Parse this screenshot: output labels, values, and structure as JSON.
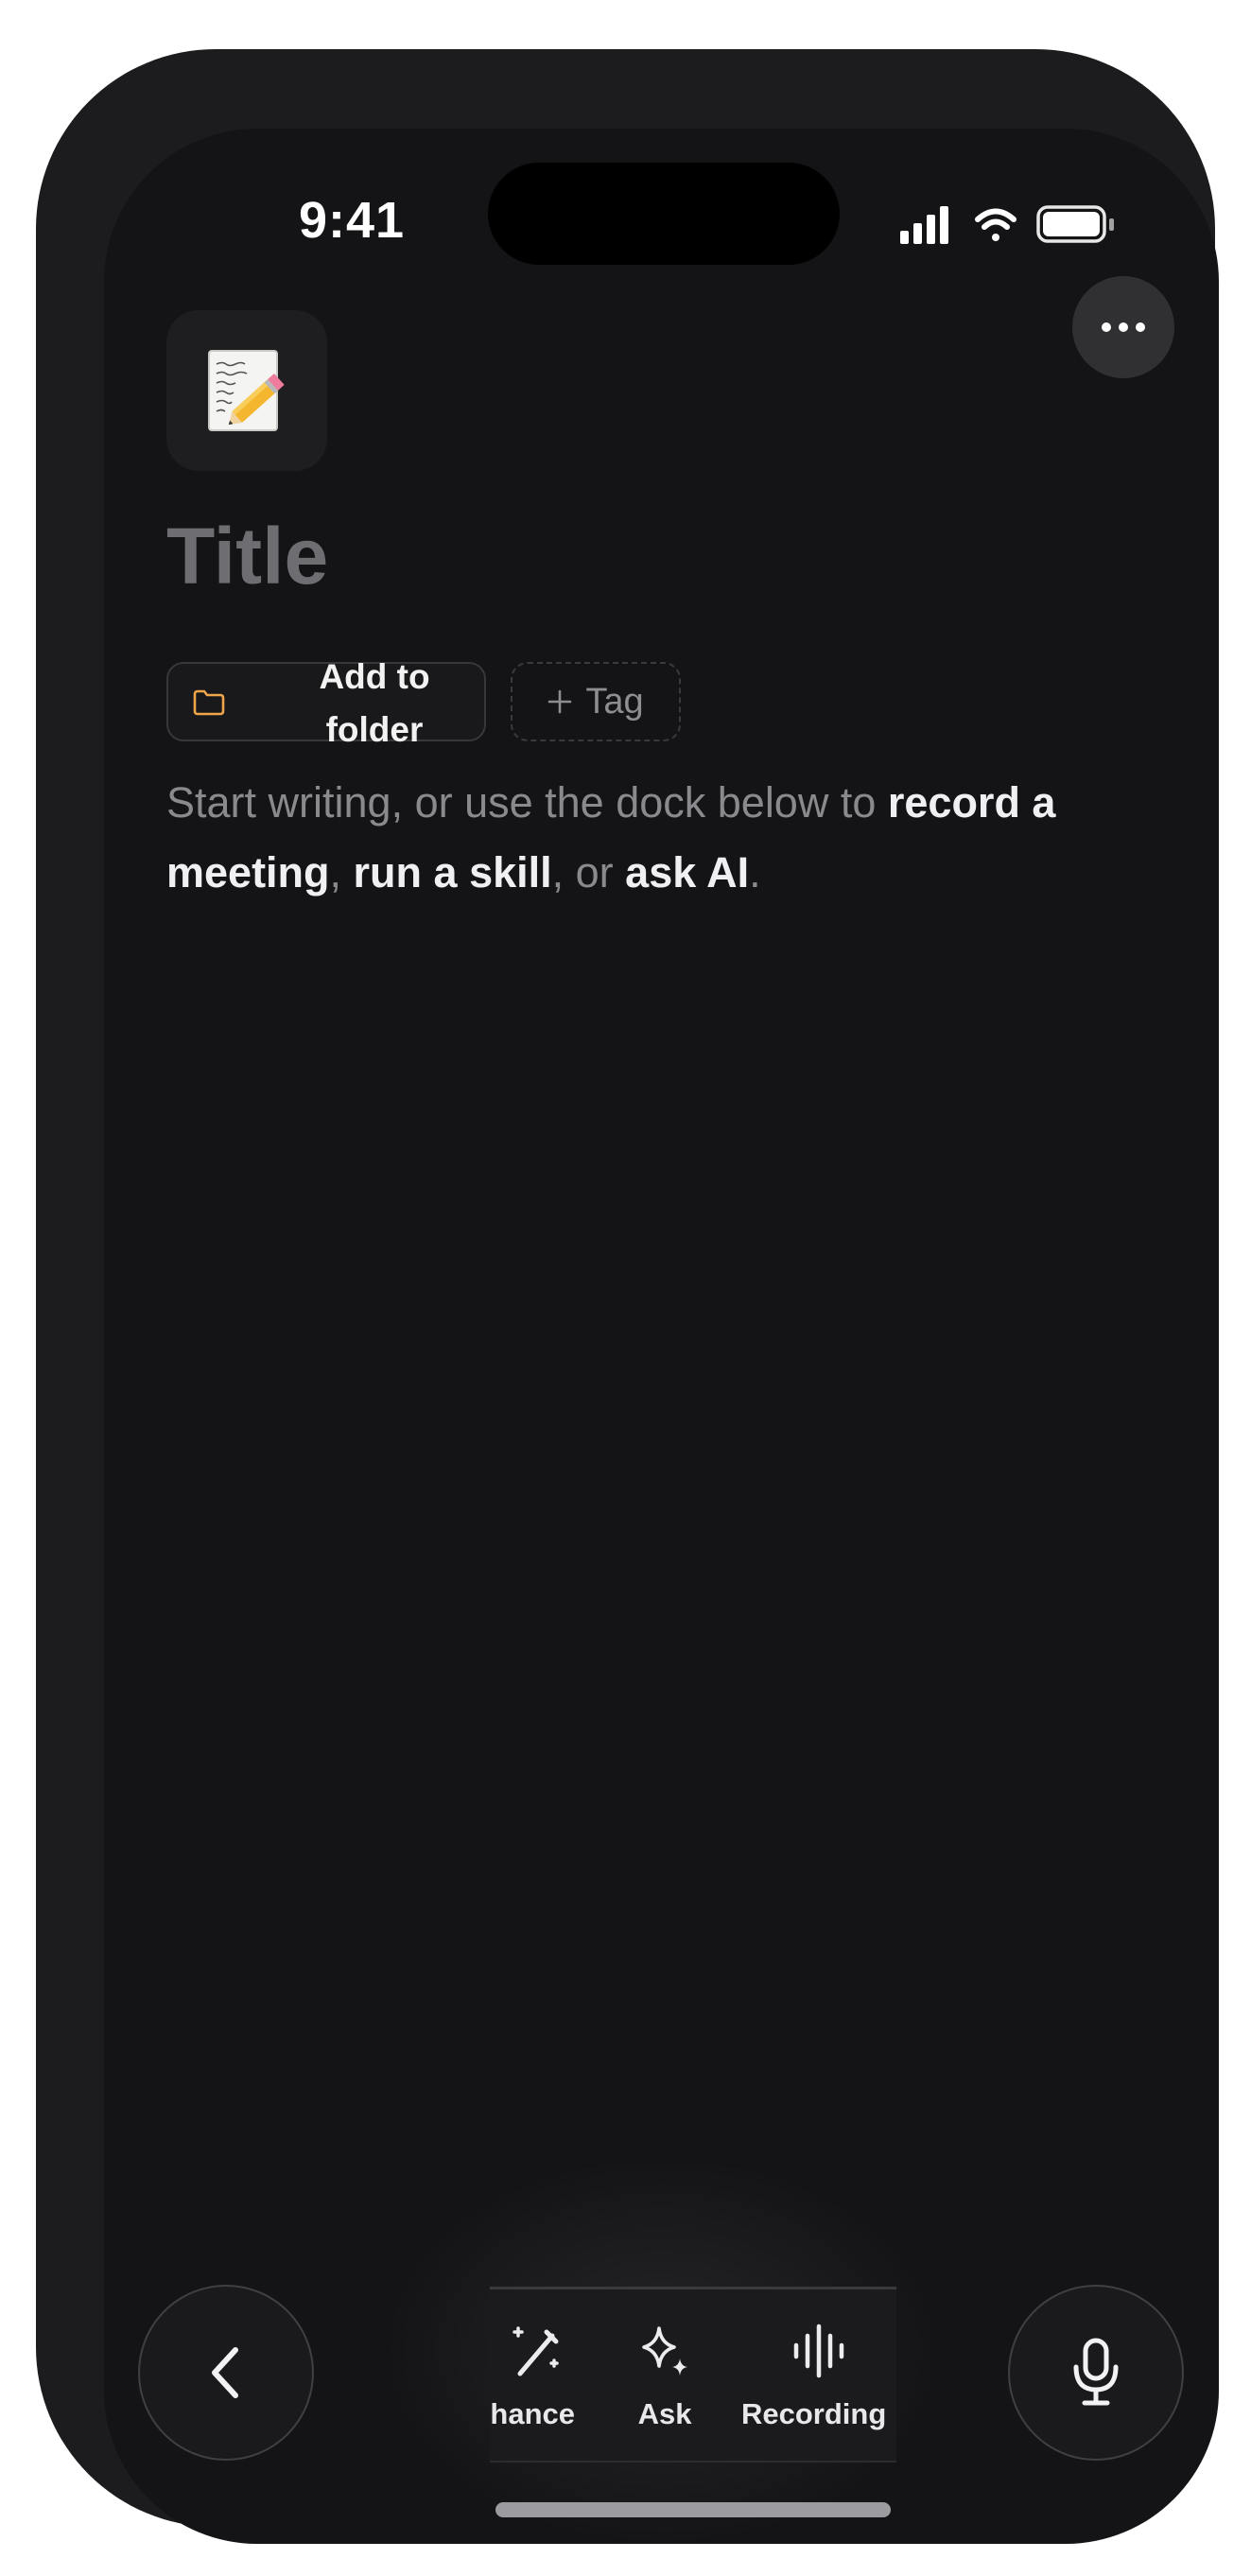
{
  "status_bar": {
    "time": "9:41"
  },
  "header": {
    "more_icon": "ellipsis-icon",
    "note_emoji": "📝"
  },
  "note": {
    "title_placeholder": "Title",
    "folder_chip_label": "Add to folder",
    "tag_chip_label": "Tag",
    "intro": {
      "part1": "Start writing, or use the dock below to ",
      "bold1": "record a meeting",
      "part2": ", ",
      "bold2": "run a skill",
      "part3": ", or ",
      "bold3": "ask AI",
      "part4": "."
    }
  },
  "dock": {
    "items": [
      {
        "label": "Enhance",
        "icon": "magic-wand-icon"
      },
      {
        "label": "Ask",
        "icon": "sparkle-icon"
      },
      {
        "label": "Recording",
        "icon": "waveform-icon"
      }
    ]
  },
  "buttons": {
    "back_icon": "chevron-left-icon",
    "mic_icon": "microphone-icon"
  },
  "colors": {
    "background": "#141416",
    "folder_accent": "#f0a54a",
    "text_primary": "#f0f0f2",
    "text_secondary": "#8a8a8e"
  }
}
